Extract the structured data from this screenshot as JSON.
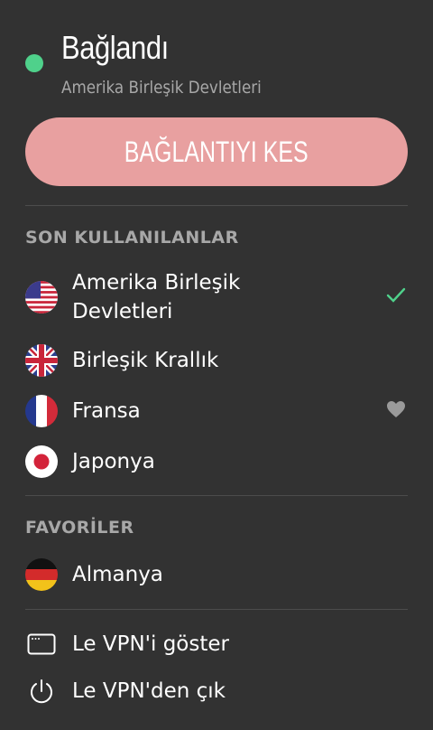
{
  "status": {
    "title": "Bağlandı",
    "subtitle": "Amerika Birleşik Devletleri",
    "color": "#4fd18b"
  },
  "disconnect_label": "BAĞLANTIYI KES",
  "recent": {
    "title": "SON KULLANILANLAR",
    "items": [
      {
        "label_line1": "Amerika Birleşik",
        "label_line2": "Devletleri",
        "flag": "us-flag-icon",
        "selected": true
      },
      {
        "label": "Birleşik Krallık",
        "flag": "uk-flag-icon"
      },
      {
        "label": "Fransa",
        "flag": "france-flag-icon",
        "favorite": true
      },
      {
        "label": "Japonya",
        "flag": "japan-flag-icon"
      }
    ]
  },
  "favorites": {
    "title": "FAVORİLER",
    "items": [
      {
        "label": "Almanya",
        "flag": "germany-flag-icon"
      }
    ]
  },
  "menu": {
    "show_label": "Le VPN'i göster",
    "quit_label": "Le VPN'den çık"
  }
}
